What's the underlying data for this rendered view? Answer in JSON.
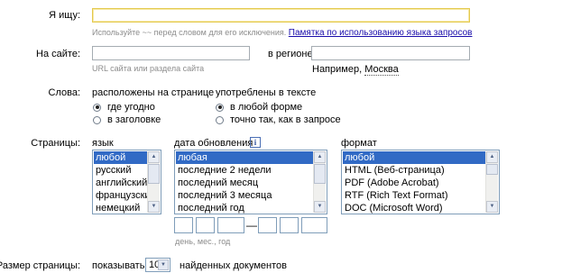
{
  "query": {
    "label": "Я ищу:",
    "value": "",
    "hint": "Используйте ~~ перед словом для его исключения.",
    "memo_link": "Памятка по использованию языка запросов"
  },
  "site": {
    "label": "На сайте:",
    "value": "",
    "hint": "URL сайта или раздела сайта"
  },
  "region": {
    "label": "в регионе",
    "value": "",
    "example_prefix": "Например,",
    "example_link": "Москва"
  },
  "words": {
    "label": "Слова:",
    "located": {
      "title": "расположены на странице",
      "options": [
        {
          "label": "где угодно",
          "checked": true
        },
        {
          "label": "в заголовке",
          "checked": false
        }
      ]
    },
    "used": {
      "title": "употреблены в тексте",
      "options": [
        {
          "label": "в любой форме",
          "checked": true
        },
        {
          "label": "точно так, как в запросе",
          "checked": false
        }
      ]
    }
  },
  "pages": {
    "label": "Страницы:",
    "language": {
      "title": "язык",
      "items": [
        "любой",
        "русский",
        "английский",
        "французский",
        "немецкий"
      ],
      "selected": 0
    },
    "updated": {
      "title": "дата обновления",
      "info_icon": "i",
      "items": [
        "любая",
        "последние 2 недели",
        "последний месяц",
        "последний 3 месяца",
        "последний год"
      ],
      "selected": 0,
      "date_hint": "день, мес., год",
      "range_dash": "—"
    },
    "format": {
      "title": "формат",
      "items": [
        "любой",
        "HTML (Веб-страница)",
        "PDF (Adobe Acrobat)",
        "RTF (Rich Text Format)",
        "DOC (Microsoft Word)"
      ],
      "selected": 0
    }
  },
  "page_size": {
    "label": "Размер страницы:",
    "show_label": "показывать",
    "value": "10",
    "suffix": "найденных документов"
  },
  "icons": {
    "scroll_up": "up-arrow-icon",
    "scroll_down": "down-arrow-icon",
    "dropdown": "chevron-down-icon",
    "info": "info-icon"
  }
}
